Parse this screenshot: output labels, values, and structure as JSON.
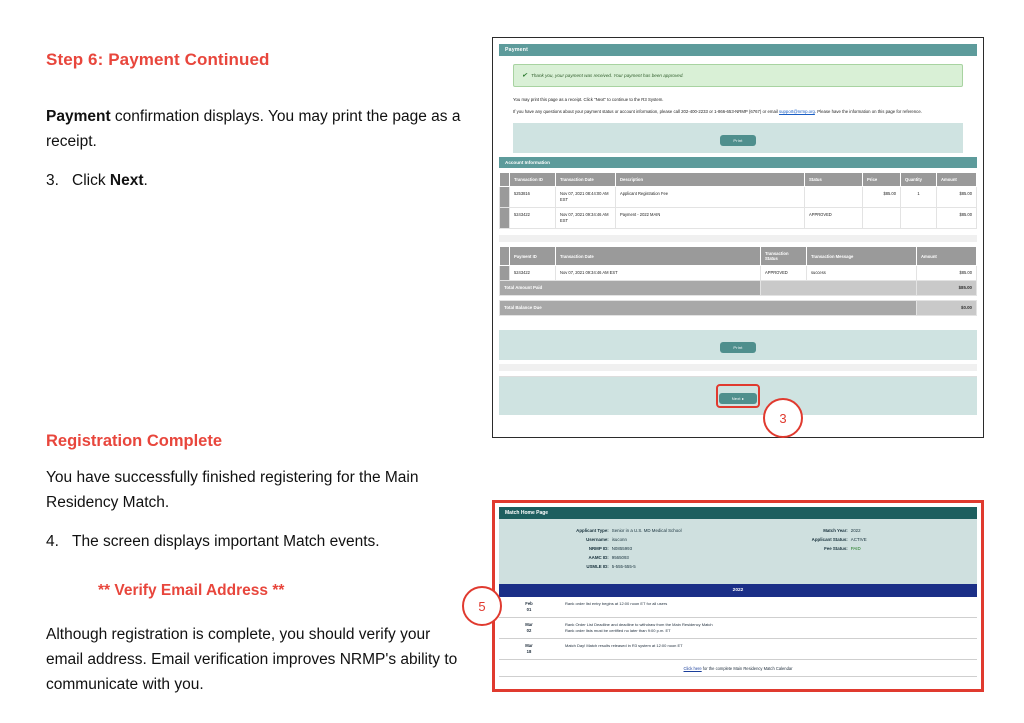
{
  "doc": {
    "step_heading": "Step 6: Payment Continued",
    "para1_bold": "Payment",
    "para1_rest": " confirmation displays. You may print the page as a receipt.",
    "step3_num": "3.",
    "step3_text_pre": "Click ",
    "step3_text_bold": "Next",
    "step3_text_post": ".",
    "complete_heading": "Registration Complete",
    "complete_para": "You have successfully finished registering for the Main Residency Match.",
    "step4_num": "4.",
    "step4_text": "The screen displays important Match events.",
    "verify_heading": "** Verify Email Address **",
    "verify_para": "Although registration is complete, you should verify your email address. Email verification improves NRMP's ability to communicate with you."
  },
  "callouts": {
    "three": "3",
    "five": "5"
  },
  "payment_screen": {
    "title": "Payment",
    "alert_icon": "check-icon",
    "alert_text": "Thank you, your payment was received. Your payment has been approved.",
    "para1": "You may print this page as a receipt. Click \"Next\" to continue to the R3 System.",
    "para2_a": "If you have any questions about your payment status or account information, please call 202-400-2233 or 1-866-653-NRMP (6767) or email ",
    "para2_link": "support@nrmp.org",
    "para2_b": ". Please have the information on this page for reference.",
    "print_label": "Print",
    "section_title": "Account Information",
    "account_table": {
      "headers": [
        "Transaction ID",
        "Transaction Date",
        "Description",
        "Status",
        "Price",
        "Quantity",
        "Amount"
      ],
      "rows": [
        {
          "id": "5253816",
          "date": "Nov 07, 2021 08:44:00 AM EST",
          "description": "Applicant Registration Fee",
          "status": "",
          "price": "$85.00",
          "quantity": "1",
          "amount": "$85.00"
        },
        {
          "id": "5243422",
          "date": "Nov 07, 2021 09:34:46 AM EST",
          "description": "Payment - 2022 MAIN",
          "status": "APPROVED",
          "price": "",
          "quantity": "",
          "amount": "$85.00"
        }
      ]
    },
    "payment_table": {
      "headers": [
        "Payment ID",
        "Transaction Date",
        "Transaction Status",
        "Transaction Message",
        "Amount"
      ],
      "rows": [
        {
          "id": "5243422",
          "date": "Nov 07, 2021 09:34:46 AM EST",
          "status": "APPROVED",
          "message": "success",
          "amount": "$85.00"
        }
      ],
      "total_paid_label": "Total Amount Paid",
      "total_paid_value": "$85.00",
      "balance_due_label": "Total Balance Due",
      "balance_due_value": "$0.00"
    },
    "print_label_bottom": "Print",
    "next_label": "Next ▸"
  },
  "match_home_screen": {
    "title": "Match Home Page",
    "info_left": [
      {
        "label": "Applicant Type:",
        "value": "Senior in a U.S. MD Medical School"
      },
      {
        "label": "Username:",
        "value": "isuconn"
      },
      {
        "label": "NRMP ID:",
        "value": "N0855993"
      },
      {
        "label": "AAMC ID:",
        "value": "9565093"
      },
      {
        "label": "USMLE ID:",
        "value": "5-555-555-5"
      }
    ],
    "info_right": [
      {
        "label": "Match Year:",
        "value": "2022",
        "accent": false
      },
      {
        "label": "Applicant Status:",
        "value": "ACTIVE",
        "accent": false
      },
      {
        "label": "Fee Status:",
        "value": "PAID",
        "accent": true
      }
    ],
    "year_bar": "2022",
    "calendar": [
      {
        "month": "Feb",
        "day": "01",
        "lines": [
          "Rank order list entry begins at 12:00 noon ET for all users"
        ]
      },
      {
        "month": "Mar",
        "day": "02",
        "lines": [
          "Rank Order List Deadline and deadline to withdraw from the Main Residency Match",
          "Rank order lists must be certified no later than 9:00 p.m. ET"
        ]
      },
      {
        "month": "Mar",
        "day": "18",
        "lines": [
          "Match Day! Match results released in R3 system at 12:00 noon ET"
        ]
      }
    ],
    "footer_link": "Click here",
    "footer_text": " for the complete Main Residency Match Calendar"
  },
  "colors": {
    "accent_red": "#e8463c",
    "teal_header": "#5d9b9b",
    "navy": "#1b2f87",
    "dark_teal": "#1d5f5f",
    "success_green": "#1f7a1f"
  }
}
